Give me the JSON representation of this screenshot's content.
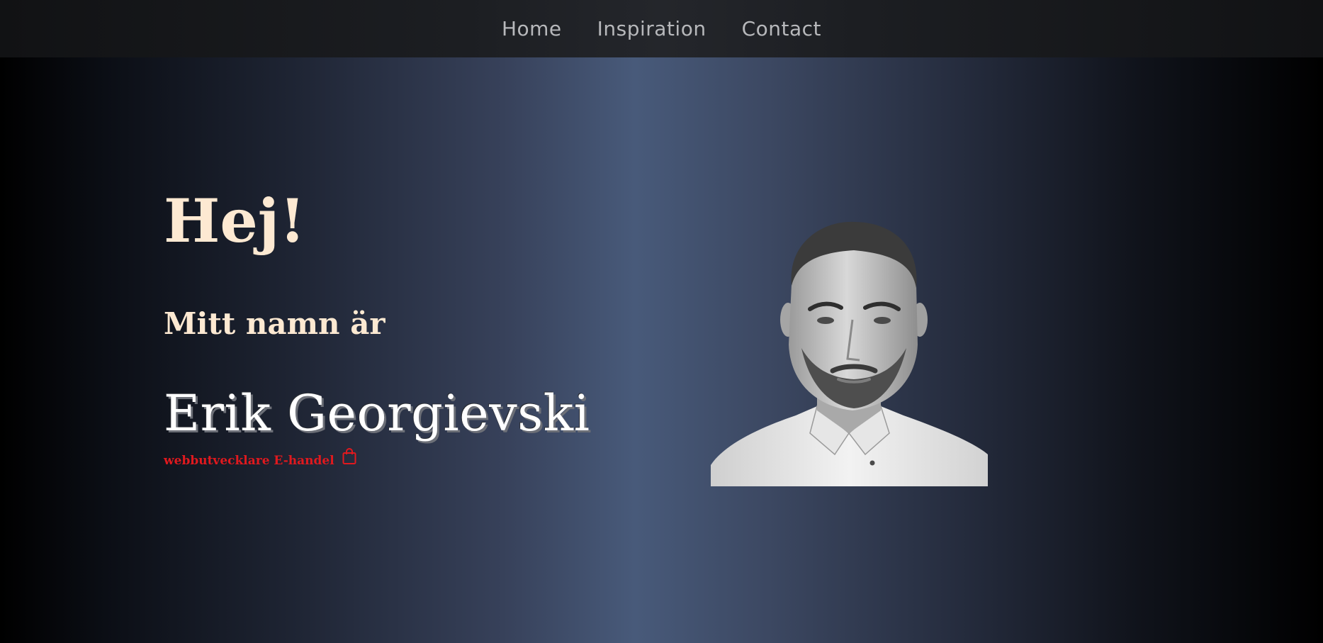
{
  "nav": {
    "items": [
      {
        "label": "Home"
      },
      {
        "label": "Inspiration"
      },
      {
        "label": "Contact"
      }
    ]
  },
  "hero": {
    "greeting": "Hej!",
    "intro": "Mitt namn är",
    "name": "Erik Georgievski",
    "tagline": "webbutvecklare E-handel",
    "tagline_icon": "shopping-bag-icon",
    "portrait_alt": "Erik Georgievski"
  },
  "colors": {
    "heading": "#fde9d2",
    "name": "#ffffff",
    "accent": "#e0191e",
    "nav_text": "#b7b8bb"
  }
}
